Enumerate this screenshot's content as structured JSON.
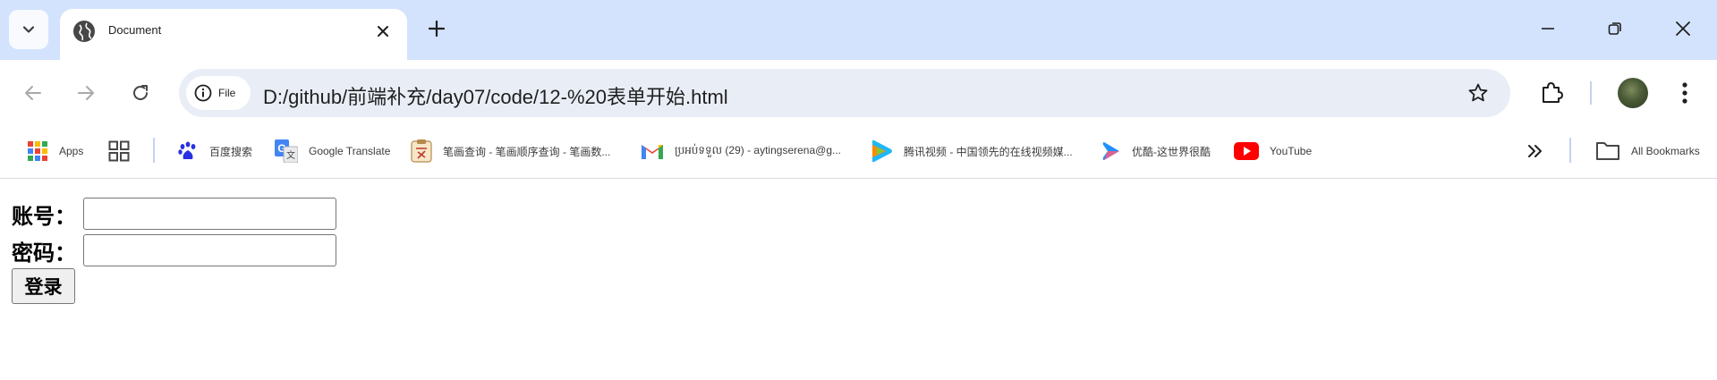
{
  "tab": {
    "title": "Document"
  },
  "omnibox": {
    "chip_label": "File",
    "url": "D:/github/前端补充/day07/code/12-%20表单开始.html"
  },
  "bookmarks": {
    "items": [
      {
        "label": "Apps",
        "icon": "apps-grid-icon"
      },
      {
        "label": "百度搜索",
        "icon": "baidu-icon"
      },
      {
        "label": "Google Translate",
        "icon": "google-translate-icon"
      },
      {
        "label": "笔画查询 - 笔画顺序查询 - 笔画数...",
        "icon": "stroke-query-icon"
      },
      {
        "label": "ប្រអប់ទទួល (29) - aytingserena@g...",
        "icon": "gmail-icon"
      },
      {
        "label": "腾讯视频 - 中国领先的在线视频媒...",
        "icon": "tencent-video-icon"
      },
      {
        "label": "优酷-这世界很酷",
        "icon": "youku-icon"
      },
      {
        "label": "YouTube",
        "icon": "youtube-icon"
      }
    ],
    "all_bookmarks": "All Bookmarks"
  },
  "form": {
    "account_label": "账号：",
    "account_value": "",
    "password_label": "密码：",
    "password_value": "",
    "submit_label": "登录"
  },
  "colors": {
    "tabstrip": "#d3e3fd",
    "omnibox": "#e9eef6",
    "youtube": "#ff0000"
  }
}
